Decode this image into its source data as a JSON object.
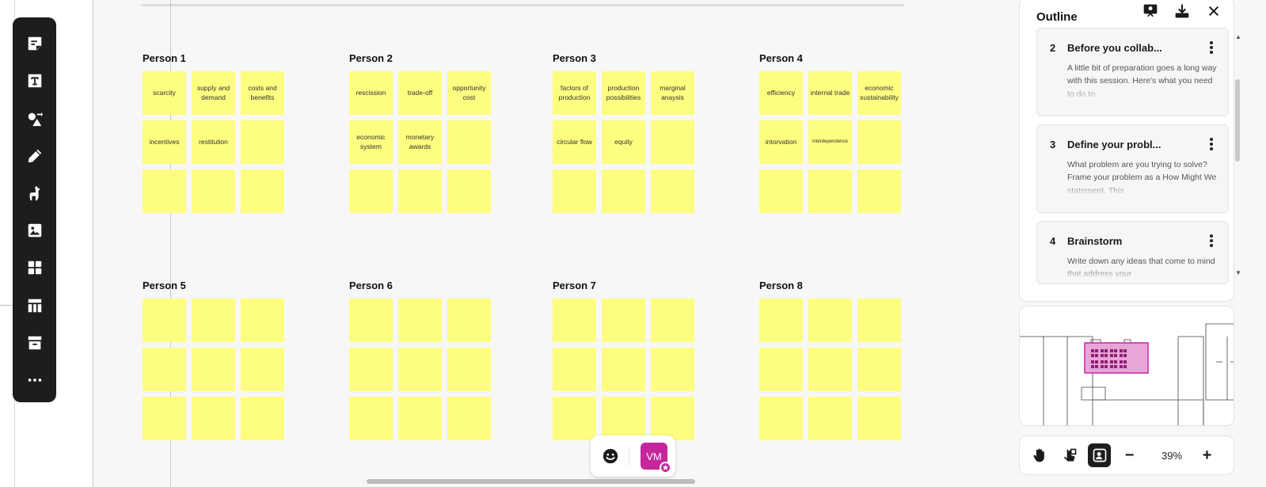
{
  "toolbar": {
    "tools": [
      "sticky-note-icon",
      "text-icon",
      "shapes-icon",
      "pen-icon",
      "llama-icon",
      "image-icon",
      "templates-icon",
      "table-icon",
      "archive-icon",
      "more-icon"
    ]
  },
  "board": {
    "groups": [
      {
        "title": "Person 1",
        "notes": [
          "scarcity",
          "supply and demand",
          "costs and benefits",
          "incentives",
          "restitution",
          "",
          "",
          "",
          ""
        ]
      },
      {
        "title": "Person 2",
        "notes": [
          "rescission",
          "trade-off",
          "opportunity cost",
          "economic system",
          "monetary awards",
          "",
          "",
          "",
          ""
        ]
      },
      {
        "title": "Person 3",
        "notes": [
          "factors of production",
          "production possibilities",
          "marginal anaysis",
          "circular flow",
          "equity",
          "",
          "",
          "",
          ""
        ]
      },
      {
        "title": "Person 4",
        "notes": [
          "efficiency",
          "internal trade",
          "economic sustainability",
          "intorvation",
          "interdependence",
          "",
          "",
          "",
          ""
        ]
      },
      {
        "title": "Person 5",
        "notes": [
          "",
          "",
          "",
          "",
          "",
          "",
          "",
          "",
          ""
        ]
      },
      {
        "title": "Person 6",
        "notes": [
          "",
          "",
          "",
          "",
          "",
          "",
          "",
          "",
          ""
        ]
      },
      {
        "title": "Person 7",
        "notes": [
          "",
          "",
          "",
          "",
          "",
          "",
          "",
          "",
          ""
        ]
      },
      {
        "title": "Person 8",
        "notes": [
          "",
          "",
          "",
          "",
          "",
          "",
          "",
          "",
          ""
        ]
      }
    ]
  },
  "presence": {
    "emoji_icon": "smiley-icon",
    "avatar_initials": "VM"
  },
  "outline": {
    "title": "Outline",
    "icons": [
      "presenter-icon",
      "download-icon",
      "close-icon"
    ],
    "items": [
      {
        "number": "2",
        "title": "Before you collab...",
        "body": "A little bit of preparation goes a long way with this session. Here's what you need to do to"
      },
      {
        "number": "3",
        "title": "Define your probl...",
        "body": "What problem are you trying to solve? Frame your problem as a How Might We statement. This"
      },
      {
        "number": "4",
        "title": "Brainstorm",
        "body": "Write down any ideas that come to mind that address your"
      }
    ]
  },
  "zoom": {
    "value": "39%",
    "minus": "−",
    "plus": "+"
  },
  "colors": {
    "sticky": "#fdfd80",
    "toolbar": "#1d1d1f",
    "avatar": "#c4269c",
    "minimap_highlight": "#e9a5d8"
  }
}
